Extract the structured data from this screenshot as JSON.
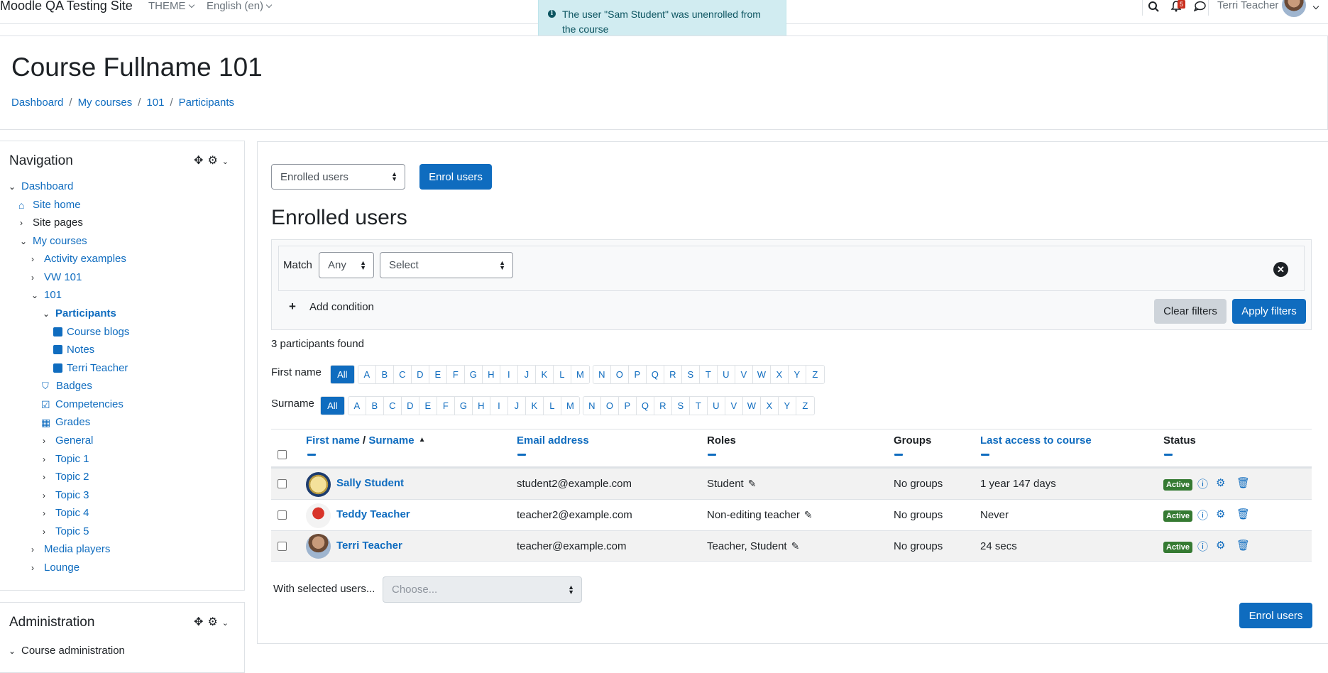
{
  "topbar": {
    "site_name": "Moodle QA Testing Site",
    "menu_theme": "THEME",
    "menu_language": "English (en)",
    "notification_count": "5",
    "user_name": "Terri Teacher"
  },
  "toast": {
    "message": "The user \"Sam Student\" was unenrolled from the course"
  },
  "header": {
    "course_title": "Course Fullname 101",
    "breadcrumb": [
      "Dashboard",
      "My courses",
      "101",
      "Participants"
    ]
  },
  "navigation": {
    "title": "Navigation",
    "items": [
      {
        "label": "Dashboard",
        "link": true
      },
      {
        "label": "Site home",
        "link": true
      },
      {
        "label": "Site pages",
        "link": false
      },
      {
        "label": "My courses",
        "link": true
      },
      {
        "label": "Activity examples",
        "link": true
      },
      {
        "label": "VW 101",
        "link": true
      },
      {
        "label": "101",
        "link": true
      },
      {
        "label": "Participants",
        "link": true
      },
      {
        "label": "Course blogs",
        "link": true
      },
      {
        "label": "Notes",
        "link": true
      },
      {
        "label": "Terri Teacher",
        "link": true
      },
      {
        "label": "Badges",
        "link": true
      },
      {
        "label": "Competencies",
        "link": true
      },
      {
        "label": "Grades",
        "link": true
      },
      {
        "label": "General",
        "link": true
      },
      {
        "label": "Topic 1",
        "link": true
      },
      {
        "label": "Topic 2",
        "link": true
      },
      {
        "label": "Topic 3",
        "link": true
      },
      {
        "label": "Topic 4",
        "link": true
      },
      {
        "label": "Topic 5",
        "link": true
      },
      {
        "label": "Media players",
        "link": true
      },
      {
        "label": "Lounge",
        "link": true
      }
    ]
  },
  "administration": {
    "title": "Administration",
    "items": [
      {
        "label": "Course administration"
      }
    ]
  },
  "main": {
    "enrol_method_select": "Enrolled users",
    "enrol_button": "Enrol users",
    "heading": "Enrolled users",
    "filter": {
      "match_label": "Match",
      "match_value": "Any",
      "type_value": "Select",
      "add_condition": "Add condition",
      "clear_filters": "Clear filters",
      "apply_filters": "Apply filters"
    },
    "participants_found": "3 participants found",
    "firstname_label": "First name",
    "surname_label": "Surname",
    "all_label": "All",
    "letters_a": [
      "A",
      "B",
      "C",
      "D",
      "E",
      "F",
      "G",
      "H",
      "I",
      "J",
      "K",
      "L",
      "M"
    ],
    "letters_n": [
      "N",
      "O",
      "P",
      "Q",
      "R",
      "S",
      "T",
      "U",
      "V",
      "W",
      "X",
      "Y",
      "Z"
    ],
    "columns": {
      "firstname": "First name",
      "slash": " / ",
      "surname": "Surname",
      "email": "Email address",
      "roles": "Roles",
      "groups": "Groups",
      "last_access": "Last access to course",
      "status": "Status"
    },
    "rows": [
      {
        "name": "Sally Student",
        "email": "student2@example.com",
        "roles": "Student",
        "groups": "No groups",
        "last_access": "1 year 147 days",
        "status": "Active"
      },
      {
        "name": "Teddy Teacher",
        "email": "teacher2@example.com",
        "roles": "Non-editing teacher",
        "groups": "No groups",
        "last_access": "Never",
        "status": "Active"
      },
      {
        "name": "Terri Teacher",
        "email": "teacher@example.com",
        "roles": "Teacher, Student",
        "groups": "No groups",
        "last_access": "24 secs",
        "status": "Active"
      }
    ],
    "with_selected_label": "With selected users...",
    "with_selected_placeholder": "Choose...",
    "enrol_button_bottom": "Enrol users"
  },
  "colors": {
    "brand": "#0f6cbf",
    "active_badge": "#357a32",
    "toast_bg": "#d1ecf1"
  }
}
